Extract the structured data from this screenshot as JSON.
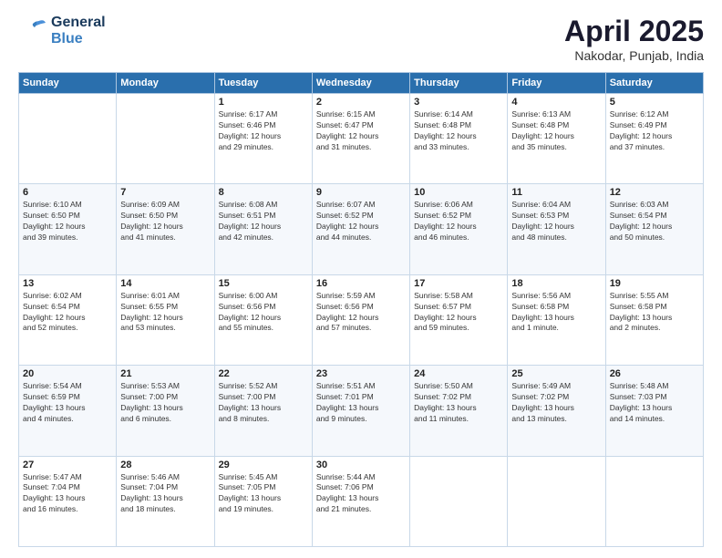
{
  "header": {
    "logo_line1": "General",
    "logo_line2": "Blue",
    "month": "April 2025",
    "location": "Nakodar, Punjab, India"
  },
  "days_of_week": [
    "Sunday",
    "Monday",
    "Tuesday",
    "Wednesday",
    "Thursday",
    "Friday",
    "Saturday"
  ],
  "weeks": [
    [
      {
        "day": "",
        "detail": ""
      },
      {
        "day": "",
        "detail": ""
      },
      {
        "day": "1",
        "detail": "Sunrise: 6:17 AM\nSunset: 6:46 PM\nDaylight: 12 hours\nand 29 minutes."
      },
      {
        "day": "2",
        "detail": "Sunrise: 6:15 AM\nSunset: 6:47 PM\nDaylight: 12 hours\nand 31 minutes."
      },
      {
        "day": "3",
        "detail": "Sunrise: 6:14 AM\nSunset: 6:48 PM\nDaylight: 12 hours\nand 33 minutes."
      },
      {
        "day": "4",
        "detail": "Sunrise: 6:13 AM\nSunset: 6:48 PM\nDaylight: 12 hours\nand 35 minutes."
      },
      {
        "day": "5",
        "detail": "Sunrise: 6:12 AM\nSunset: 6:49 PM\nDaylight: 12 hours\nand 37 minutes."
      }
    ],
    [
      {
        "day": "6",
        "detail": "Sunrise: 6:10 AM\nSunset: 6:50 PM\nDaylight: 12 hours\nand 39 minutes."
      },
      {
        "day": "7",
        "detail": "Sunrise: 6:09 AM\nSunset: 6:50 PM\nDaylight: 12 hours\nand 41 minutes."
      },
      {
        "day": "8",
        "detail": "Sunrise: 6:08 AM\nSunset: 6:51 PM\nDaylight: 12 hours\nand 42 minutes."
      },
      {
        "day": "9",
        "detail": "Sunrise: 6:07 AM\nSunset: 6:52 PM\nDaylight: 12 hours\nand 44 minutes."
      },
      {
        "day": "10",
        "detail": "Sunrise: 6:06 AM\nSunset: 6:52 PM\nDaylight: 12 hours\nand 46 minutes."
      },
      {
        "day": "11",
        "detail": "Sunrise: 6:04 AM\nSunset: 6:53 PM\nDaylight: 12 hours\nand 48 minutes."
      },
      {
        "day": "12",
        "detail": "Sunrise: 6:03 AM\nSunset: 6:54 PM\nDaylight: 12 hours\nand 50 minutes."
      }
    ],
    [
      {
        "day": "13",
        "detail": "Sunrise: 6:02 AM\nSunset: 6:54 PM\nDaylight: 12 hours\nand 52 minutes."
      },
      {
        "day": "14",
        "detail": "Sunrise: 6:01 AM\nSunset: 6:55 PM\nDaylight: 12 hours\nand 53 minutes."
      },
      {
        "day": "15",
        "detail": "Sunrise: 6:00 AM\nSunset: 6:56 PM\nDaylight: 12 hours\nand 55 minutes."
      },
      {
        "day": "16",
        "detail": "Sunrise: 5:59 AM\nSunset: 6:56 PM\nDaylight: 12 hours\nand 57 minutes."
      },
      {
        "day": "17",
        "detail": "Sunrise: 5:58 AM\nSunset: 6:57 PM\nDaylight: 12 hours\nand 59 minutes."
      },
      {
        "day": "18",
        "detail": "Sunrise: 5:56 AM\nSunset: 6:58 PM\nDaylight: 13 hours\nand 1 minute."
      },
      {
        "day": "19",
        "detail": "Sunrise: 5:55 AM\nSunset: 6:58 PM\nDaylight: 13 hours\nand 2 minutes."
      }
    ],
    [
      {
        "day": "20",
        "detail": "Sunrise: 5:54 AM\nSunset: 6:59 PM\nDaylight: 13 hours\nand 4 minutes."
      },
      {
        "day": "21",
        "detail": "Sunrise: 5:53 AM\nSunset: 7:00 PM\nDaylight: 13 hours\nand 6 minutes."
      },
      {
        "day": "22",
        "detail": "Sunrise: 5:52 AM\nSunset: 7:00 PM\nDaylight: 13 hours\nand 8 minutes."
      },
      {
        "day": "23",
        "detail": "Sunrise: 5:51 AM\nSunset: 7:01 PM\nDaylight: 13 hours\nand 9 minutes."
      },
      {
        "day": "24",
        "detail": "Sunrise: 5:50 AM\nSunset: 7:02 PM\nDaylight: 13 hours\nand 11 minutes."
      },
      {
        "day": "25",
        "detail": "Sunrise: 5:49 AM\nSunset: 7:02 PM\nDaylight: 13 hours\nand 13 minutes."
      },
      {
        "day": "26",
        "detail": "Sunrise: 5:48 AM\nSunset: 7:03 PM\nDaylight: 13 hours\nand 14 minutes."
      }
    ],
    [
      {
        "day": "27",
        "detail": "Sunrise: 5:47 AM\nSunset: 7:04 PM\nDaylight: 13 hours\nand 16 minutes."
      },
      {
        "day": "28",
        "detail": "Sunrise: 5:46 AM\nSunset: 7:04 PM\nDaylight: 13 hours\nand 18 minutes."
      },
      {
        "day": "29",
        "detail": "Sunrise: 5:45 AM\nSunset: 7:05 PM\nDaylight: 13 hours\nand 19 minutes."
      },
      {
        "day": "30",
        "detail": "Sunrise: 5:44 AM\nSunset: 7:06 PM\nDaylight: 13 hours\nand 21 minutes."
      },
      {
        "day": "",
        "detail": ""
      },
      {
        "day": "",
        "detail": ""
      },
      {
        "day": "",
        "detail": ""
      }
    ]
  ]
}
